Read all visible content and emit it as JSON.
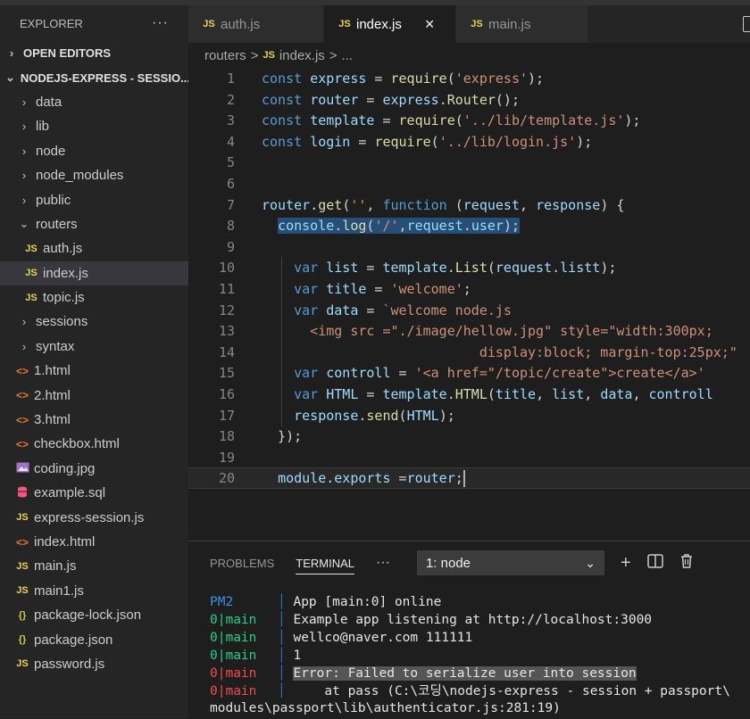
{
  "explorer": {
    "title": "EXPLORER",
    "more": "···",
    "open_editors": "OPEN EDITORS",
    "project": "NODEJS-EXPRESS - SESSIO...",
    "items": [
      {
        "label": "data",
        "type": "folder"
      },
      {
        "label": "lib",
        "type": "folder"
      },
      {
        "label": "node",
        "type": "folder"
      },
      {
        "label": "node_modules",
        "type": "folder"
      },
      {
        "label": "public",
        "type": "folder"
      },
      {
        "label": "routers",
        "type": "folder-open"
      },
      {
        "label": "auth.js",
        "type": "js"
      },
      {
        "label": "index.js",
        "type": "js"
      },
      {
        "label": "topic.js",
        "type": "js"
      },
      {
        "label": "sessions",
        "type": "folder"
      },
      {
        "label": "syntax",
        "type": "folder"
      },
      {
        "label": "1.html",
        "type": "html"
      },
      {
        "label": "2.html",
        "type": "html"
      },
      {
        "label": "3.html",
        "type": "html"
      },
      {
        "label": "checkbox.html",
        "type": "html"
      },
      {
        "label": "coding.jpg",
        "type": "image"
      },
      {
        "label": "example.sql",
        "type": "sql"
      },
      {
        "label": "express-session.js",
        "type": "js"
      },
      {
        "label": "index.html",
        "type": "html"
      },
      {
        "label": "main.js",
        "type": "js"
      },
      {
        "label": "main1.js",
        "type": "js"
      },
      {
        "label": "package-lock.json",
        "type": "json"
      },
      {
        "label": "package.json",
        "type": "json"
      },
      {
        "label": "password.js",
        "type": "js"
      }
    ]
  },
  "icons": {
    "js": "JS",
    "html": "<>",
    "json": "{}",
    "sql": "db-icon",
    "image": "image-icon"
  },
  "tabs": [
    {
      "label": "auth.js",
      "active": false
    },
    {
      "label": "index.js",
      "active": true
    },
    {
      "label": "main.js",
      "active": false
    }
  ],
  "tab_close": "×",
  "breadcrumb": {
    "folder": "routers",
    "sep": ">",
    "file": "index.js",
    "rest": "..."
  },
  "editor": {
    "lines": [
      {
        "n": "1",
        "tokens": [
          [
            "kw",
            "const "
          ],
          [
            "vr",
            "express"
          ],
          [
            "pl",
            " = "
          ],
          [
            "fn",
            "require"
          ],
          [
            "pl",
            "("
          ],
          [
            "st",
            "'express'"
          ],
          [
            "pl",
            ");"
          ]
        ]
      },
      {
        "n": "2",
        "tokens": [
          [
            "kw",
            "const "
          ],
          [
            "vr",
            "router"
          ],
          [
            "pl",
            " = "
          ],
          [
            "vr",
            "express"
          ],
          [
            "pl",
            "."
          ],
          [
            "fn",
            "Router"
          ],
          [
            "pl",
            "();"
          ]
        ]
      },
      {
        "n": "3",
        "tokens": [
          [
            "kw",
            "const "
          ],
          [
            "vr",
            "template"
          ],
          [
            "pl",
            " = "
          ],
          [
            "fn",
            "require"
          ],
          [
            "pl",
            "("
          ],
          [
            "st",
            "'../lib/template.js'"
          ],
          [
            "pl",
            ");"
          ]
        ]
      },
      {
        "n": "4",
        "tokens": [
          [
            "kw",
            "const "
          ],
          [
            "vr",
            "login"
          ],
          [
            "pl",
            " = "
          ],
          [
            "fn",
            "require"
          ],
          [
            "pl",
            "("
          ],
          [
            "st",
            "'../lib/login.js'"
          ],
          [
            "pl",
            ");"
          ]
        ]
      },
      {
        "n": "5",
        "tokens": []
      },
      {
        "n": "6",
        "tokens": []
      },
      {
        "n": "7",
        "tokens": [
          [
            "vr",
            "router"
          ],
          [
            "pl",
            "."
          ],
          [
            "fn",
            "get"
          ],
          [
            "pl",
            "("
          ],
          [
            "st",
            "''"
          ],
          [
            "pl",
            ", "
          ],
          [
            "kw",
            "function"
          ],
          [
            "pl",
            " ("
          ],
          [
            "vr",
            "request"
          ],
          [
            "pl",
            ", "
          ],
          [
            "vr",
            "response"
          ],
          [
            "pl",
            ") {"
          ]
        ]
      },
      {
        "n": "8",
        "tokens": [
          [
            "pl",
            "  "
          ],
          [
            "sel_vr",
            "console"
          ],
          [
            "sel_pl",
            "."
          ],
          [
            "sel_fn",
            "log"
          ],
          [
            "sel_pl",
            "("
          ],
          [
            "sel_st",
            "'/'"
          ],
          [
            "sel_pl",
            ","
          ],
          [
            "sel_vr",
            "request"
          ],
          [
            "sel_pl",
            "."
          ],
          [
            "sel_vr",
            "user"
          ],
          [
            "sel_pl",
            ");"
          ]
        ]
      },
      {
        "n": "9",
        "tokens": []
      },
      {
        "n": "10",
        "tokens": [
          [
            "pl",
            "    "
          ],
          [
            "kw",
            "var "
          ],
          [
            "vr",
            "list"
          ],
          [
            "pl",
            " = "
          ],
          [
            "vr",
            "template"
          ],
          [
            "pl",
            "."
          ],
          [
            "fn",
            "List"
          ],
          [
            "pl",
            "("
          ],
          [
            "vr",
            "request"
          ],
          [
            "pl",
            "."
          ],
          [
            "vr",
            "listt"
          ],
          [
            "pl",
            ");"
          ]
        ]
      },
      {
        "n": "11",
        "tokens": [
          [
            "pl",
            "    "
          ],
          [
            "kw",
            "var "
          ],
          [
            "vr",
            "title"
          ],
          [
            "pl",
            " = "
          ],
          [
            "st",
            "'welcome'"
          ],
          [
            "pl",
            ";"
          ]
        ]
      },
      {
        "n": "12",
        "tokens": [
          [
            "pl",
            "    "
          ],
          [
            "kw",
            "var "
          ],
          [
            "vr",
            "data"
          ],
          [
            "pl",
            " = "
          ],
          [
            "st",
            "`welcome node.js"
          ]
        ]
      },
      {
        "n": "13",
        "tokens": [
          [
            "st",
            "      <img src =\"./image/hellow.jpg\" style=\"width:300px;"
          ]
        ]
      },
      {
        "n": "14",
        "tokens": [
          [
            "st",
            "                           display:block; margin-top:25px;\""
          ]
        ]
      },
      {
        "n": "15",
        "tokens": [
          [
            "pl",
            "    "
          ],
          [
            "kw",
            "var "
          ],
          [
            "vr",
            "controll"
          ],
          [
            "pl",
            " = "
          ],
          [
            "st",
            "'<a href=\"/topic/create\">create</a>'"
          ]
        ]
      },
      {
        "n": "16",
        "tokens": [
          [
            "pl",
            "    "
          ],
          [
            "kw",
            "var "
          ],
          [
            "vr",
            "HTML"
          ],
          [
            "pl",
            " = "
          ],
          [
            "vr",
            "template"
          ],
          [
            "pl",
            "."
          ],
          [
            "fn",
            "HTML"
          ],
          [
            "pl",
            "("
          ],
          [
            "vr",
            "title"
          ],
          [
            "pl",
            ", "
          ],
          [
            "vr",
            "list"
          ],
          [
            "pl",
            ", "
          ],
          [
            "vr",
            "data"
          ],
          [
            "pl",
            ", "
          ],
          [
            "vr",
            "controll"
          ]
        ]
      },
      {
        "n": "17",
        "tokens": [
          [
            "pl",
            "    "
          ],
          [
            "vr",
            "response"
          ],
          [
            "pl",
            "."
          ],
          [
            "fn",
            "send"
          ],
          [
            "pl",
            "("
          ],
          [
            "vr",
            "HTML"
          ],
          [
            "pl",
            ");"
          ]
        ]
      },
      {
        "n": "18",
        "tokens": [
          [
            "pl",
            "  });"
          ]
        ]
      },
      {
        "n": "19",
        "tokens": []
      },
      {
        "n": "20",
        "tokens": [
          [
            "pl",
            "  "
          ],
          [
            "vr",
            "module"
          ],
          [
            "pl",
            "."
          ],
          [
            "vr",
            "exports"
          ],
          [
            "pl",
            " ="
          ],
          [
            "vr",
            "router"
          ],
          [
            "pl",
            ";"
          ]
        ]
      }
    ]
  },
  "panel": {
    "tabs": [
      "PROBLEMS",
      "TERMINAL"
    ],
    "active_tab": "TERMINAL",
    "more": "···",
    "terminal_select": "1: node",
    "actions": {
      "add": "+",
      "split": "split-icon",
      "trash": "trash-icon"
    }
  },
  "terminal": [
    {
      "src": "PM2",
      "color": "blue",
      "msg": "App [main:0] online"
    },
    {
      "src": "0|main",
      "color": "green",
      "msg": "Example app listening at http://localhost:3000"
    },
    {
      "src": "0|main",
      "color": "green",
      "msg": "wellco@naver.com 111111"
    },
    {
      "src": "0|main",
      "color": "green",
      "msg": "1"
    },
    {
      "src": "0|main",
      "color": "red",
      "msg": "Error: Failed to serialize user into session",
      "highlight": true
    },
    {
      "src": "0|main",
      "color": "red",
      "msg": "    at pass (C:\\코딩\\nodejs-express - session + passport\\"
    }
  ],
  "terminal_wrap": "modules\\passport\\lib\\authenticator.js:281:19)"
}
